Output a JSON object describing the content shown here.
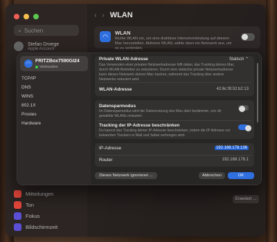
{
  "settings": {
    "search_placeholder": "Suchen",
    "user_name": "Stefan Droege",
    "user_sub": "Apple Account",
    "page_title": "WLAN",
    "wlan_card": {
      "title": "WLAN",
      "desc": "Richte WLAN ein, um eine drahtlose Internetverbindung auf deinem Mac herzustellen. Aktiviere WLAN, wähle dann ein Netzwerk aus, um es zu verbinden."
    },
    "bottom_items": [
      "Mitteilungen",
      "Ton",
      "Fokus",
      "Bildschirmzeit"
    ],
    "erweitert": "Erweitert ..."
  },
  "sheet": {
    "network": {
      "name": "FRITZBox7590GI24",
      "status": "Verbunden"
    },
    "categories": [
      "TCP/IP",
      "DNS",
      "WINS",
      "802.1X",
      "Proxies",
      "Hardware"
    ],
    "private": {
      "title": "Private WLAN-Adresse",
      "value": "Statisch",
      "desc": "Das Verwenden einer privaten Netzwerkadresse hilft dabei, das Tracking deines Mac durch WLAN-Betreiber zu reduzieren. Durch eine statische private Netzwerkadresse kann dieses Netzwerk deinen Mac tracken, während das Tracking über andere Netzwerke reduziert wird."
    },
    "wlan_address": {
      "label": "WLAN-Adresse",
      "value": "42:6c:f8:02:b2:13"
    },
    "datensparmodus": {
      "title": "Datensparmodus",
      "desc": "Im Datensparmodus wird die Datennutzung des Mac über bestimmte, von dir gewählte WLANs reduziert."
    },
    "tracking": {
      "title": "Tracking der IP-Adresse beschränken",
      "desc": "Du kannst das Tracking deiner IP-Adresse beschränken, indem die IP-Adresse vor bekannten Trackern in Mail und Safari verborgen wird."
    },
    "ip": {
      "label": "IP-Adresse",
      "value": "192.168.178.136"
    },
    "router": {
      "label": "Router",
      "value": "192.168.178.1"
    },
    "buttons": {
      "ignore": "Dieses Netzwerk ignorieren ...",
      "cancel": "Abbrechen",
      "ok": "OK"
    }
  },
  "colors": {
    "accent": "#2f6fe0",
    "connected": "#3ccf4e"
  }
}
